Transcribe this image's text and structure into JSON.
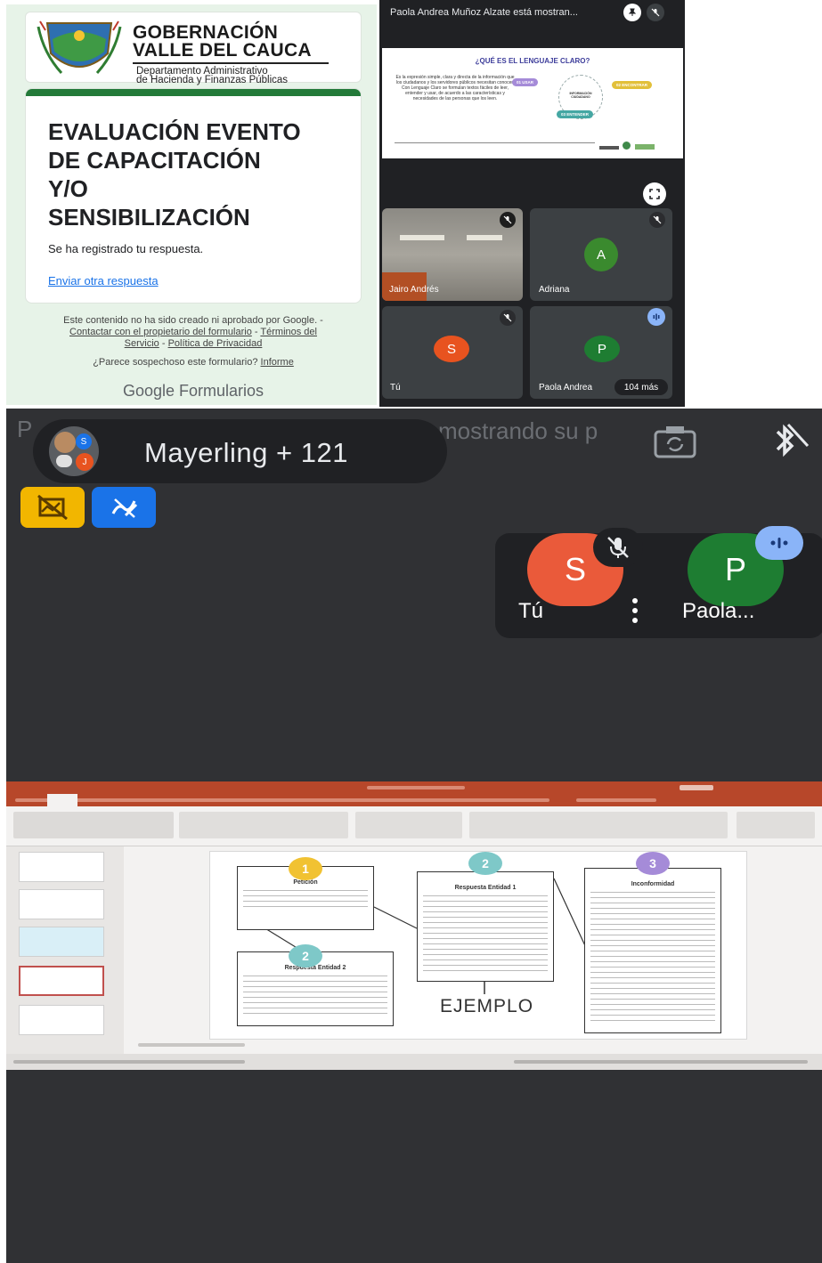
{
  "form": {
    "header": {
      "title_line1": "GOBERNACIÓN",
      "title_line2": "VALLE DEL CAUCA",
      "sub_line1": "Departamento Administrativo",
      "sub_line2": "de Hacienda y Finanzas Públicas"
    },
    "title_lines": [
      "EVALUACIÓN EVENTO",
      "DE CAPACITACIÓN",
      "Y/O",
      "SENSIBILIZACIÓN"
    ],
    "registered": "Se ha registrado tu respuesta.",
    "another_link": "Enviar otra respuesta",
    "disclaimer_line1": "Este contenido no ha sido creado ni aprobado por Google. -",
    "contact_link": "Contactar con el propietario del formulario",
    "terms_link_a": "Términos del",
    "terms_link_b": "Servicio",
    "privacy_link": "Política de Privacidad",
    "suspicious": "¿Parece sospechoso este formulario?",
    "report_link": "Informe",
    "footer_logo": "Google",
    "footer_product": "Formularios"
  },
  "meet_grid": {
    "presenting_text": "Paola Andrea Muñoz Alzate está mostran...",
    "slide": {
      "question": "¿QUÉ ES EL LENGUAJE CLARO?",
      "body": "Es la expresión simple, clara y directa de la información que los ciudadanos y los servidores públicos necesitan conocer. Con Lenguaje Claro se formulan textos fáciles de leer, entender y usar, de acuerdo a las características y necesidades de las personas que los leen.",
      "center_label": "INFORMACIÓN CIUDADANO",
      "steps": [
        {
          "num": "01",
          "label": "USAR"
        },
        {
          "num": "02",
          "label": "ENCONTRAR"
        },
        {
          "num": "03",
          "label": "ENTENDER"
        }
      ]
    },
    "tiles": [
      {
        "name": "Jairo Andrés",
        "initial": ""
      },
      {
        "name": "Adriana",
        "initial": "A",
        "color": "#3a8a2e"
      },
      {
        "name": "Tú",
        "initial": "S",
        "color": "#e8531f"
      },
      {
        "name": "Paola Andrea",
        "initial": "P",
        "color": "#1e7d32"
      }
    ],
    "more_count": "104 más"
  },
  "phone": {
    "pill_name": "Mayerling + 121",
    "bg_caption": "mostrando su p",
    "bg_caption_prefix": "P",
    "mini_avatars": [
      "S",
      "J"
    ],
    "float_tiles": [
      {
        "name": "Tú",
        "initial": "S",
        "color": "#ea5a3a"
      },
      {
        "name": "Paola...",
        "initial": "P",
        "color": "#1e7d32"
      }
    ],
    "colors": {
      "yellow_btn": "#f2b600",
      "blue_btn": "#1a73e8"
    }
  },
  "powerpoint": {
    "boxes": [
      {
        "num": "1",
        "title": "Petición",
        "color": "#f1c232"
      },
      {
        "num": "2",
        "title": "Respuesta Entidad 1",
        "color": "#7ec8c8"
      },
      {
        "num": "3",
        "title": "Inconformidad",
        "color": "#a58bd8"
      },
      {
        "num": "2",
        "title": "Respuesta Entidad 2",
        "color": "#7ec8c8"
      }
    ],
    "example_label": "EJEMPLO"
  }
}
